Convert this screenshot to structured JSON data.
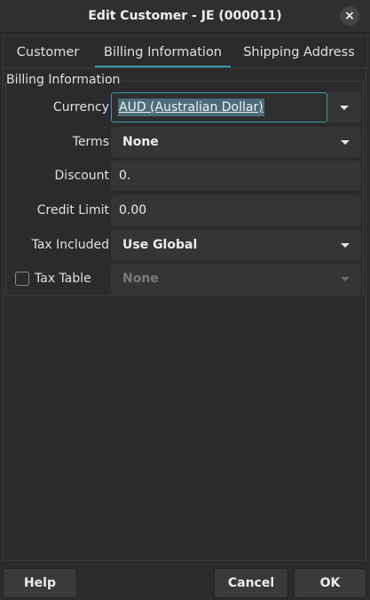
{
  "window": {
    "title": "Edit Customer - JE (000011)",
    "close_glyph": "×"
  },
  "tabs": [
    {
      "label": "Customer",
      "active": false
    },
    {
      "label": "Billing Information",
      "active": true
    },
    {
      "label": "Shipping Address",
      "active": false
    }
  ],
  "billing": {
    "section_title": "Billing Information",
    "currency": {
      "label": "Currency",
      "value": "AUD (Australian Dollar)"
    },
    "terms": {
      "label": "Terms",
      "value": "None"
    },
    "discount": {
      "label": "Discount",
      "value": "0."
    },
    "credit_limit": {
      "label": "Credit Limit",
      "value": "0.00"
    },
    "tax_included": {
      "label": "Tax Included",
      "value": "Use Global"
    },
    "tax_table": {
      "label": "Tax Table",
      "value": "None",
      "checked": false,
      "enabled": false
    }
  },
  "buttons": {
    "help": "Help",
    "cancel": "Cancel",
    "ok": "OK"
  },
  "colors": {
    "accent": "#3f97a8",
    "background": "#2b2b2b",
    "field": "#353535"
  }
}
